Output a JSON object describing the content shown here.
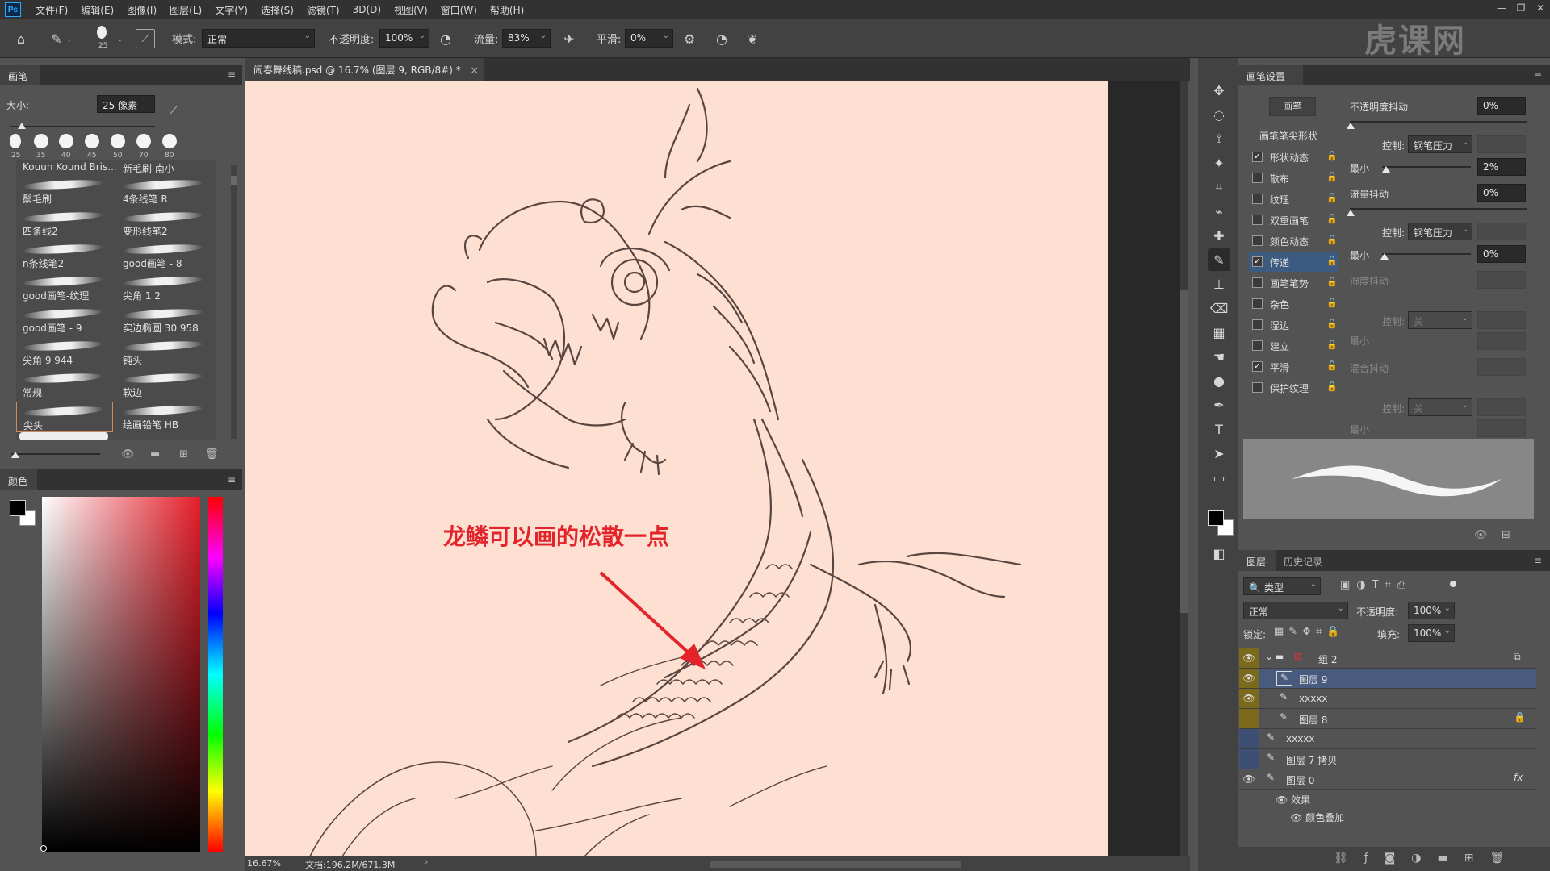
{
  "menubar": {
    "logo": "Ps",
    "items": [
      "文件(F)",
      "编辑(E)",
      "图像(I)",
      "图层(L)",
      "文字(Y)",
      "选择(S)",
      "滤镜(T)",
      "3D(D)",
      "视图(V)",
      "窗口(W)",
      "帮助(H)"
    ]
  },
  "options": {
    "brush_size": "25",
    "mode_label": "模式:",
    "mode_value": "正常",
    "opacity_label": "不透明度:",
    "opacity_value": "100%",
    "flow_label": "流量:",
    "flow_value": "83%",
    "smooth_label": "平滑:",
    "smooth_value": "0%"
  },
  "watermark": "虎课网",
  "document_tab": {
    "title": "闹春舞线稿.psd @ 16.7% (图层 9, RGB/8#) *",
    "close": "×"
  },
  "brush_panel": {
    "tab": "画笔",
    "size_label": "大小:",
    "size_value": "25 像素",
    "tip_sizes": [
      "25",
      "35",
      "40",
      "45",
      "50",
      "70",
      "80"
    ],
    "brushes_left": [
      "Kouun Kound Bris...",
      "鬃毛刷",
      "四条线2",
      "n条线笔2",
      "good画笔-纹理",
      "good画笔 - 9",
      "尖角 9 944",
      "常规",
      "尖头"
    ],
    "brushes_right": [
      "新毛刷 南小",
      "4条线笔 R",
      "变形线笔2",
      "good画笔 - 8",
      "尖角 1 2",
      "实边椭圆 30 958",
      "钝头",
      "软边",
      "绘画铅笔 HB"
    ]
  },
  "color_panel": {
    "tab": "颜色"
  },
  "canvas": {
    "annotation": "龙鳞可以画的松散一点",
    "background": "#fde0d2",
    "stroke": "#5a4640",
    "arrow_color": "#e3242b"
  },
  "status": {
    "zoom": "16.67%",
    "doc": "文档:196.2M/671.3M"
  },
  "brush_settings": {
    "tab": "画笔设置",
    "brush_button": "画笔",
    "tip_shape": "画笔笔尖形状",
    "options": [
      {
        "label": "形状动态",
        "checked": true
      },
      {
        "label": "散布",
        "checked": false
      },
      {
        "label": "纹理",
        "checked": false
      },
      {
        "label": "双重画笔",
        "checked": false
      },
      {
        "label": "颜色动态",
        "checked": false
      },
      {
        "label": "传递",
        "checked": true
      },
      {
        "label": "画笔笔势",
        "checked": false
      },
      {
        "label": "杂色",
        "checked": false
      },
      {
        "label": "湿边",
        "checked": false
      },
      {
        "label": "建立",
        "checked": false
      },
      {
        "label": "平滑",
        "checked": true
      },
      {
        "label": "保护纹理",
        "checked": false
      }
    ],
    "opacity_jitter_label": "不透明度抖动",
    "opacity_jitter_value": "0%",
    "control_label": "控制:",
    "control_value": "钢笔压力",
    "min_label": "最小",
    "min_value_1": "2%",
    "flow_jitter_label": "流量抖动",
    "flow_jitter_value": "0%",
    "min_value_2": "0%",
    "wet_jitter_label": "湿度抖动",
    "mix_jitter_label": "混合抖动",
    "control_off": "关"
  },
  "layers_panel": {
    "tabs": [
      "图层",
      "历史记录"
    ],
    "filter_label": "类型",
    "blend_mode": "正常",
    "opacity_label": "不透明度:",
    "opacity_value": "100%",
    "lock_label": "锁定:",
    "fill_label": "填充:",
    "fill_value": "100%",
    "layers": [
      {
        "name": "组 2",
        "type": "group"
      },
      {
        "name": "图层 9",
        "type": "layer"
      },
      {
        "name": "xxxxx",
        "type": "layer"
      },
      {
        "name": "图层 8",
        "type": "layer"
      },
      {
        "name": "xxxxx",
        "type": "layer"
      },
      {
        "name": "图层 7 拷贝",
        "type": "layer"
      },
      {
        "name": "图层 0",
        "type": "layer"
      }
    ],
    "effects_label": "效果",
    "color_overlay_label": "颜色叠加",
    "fx_label": "fx"
  }
}
